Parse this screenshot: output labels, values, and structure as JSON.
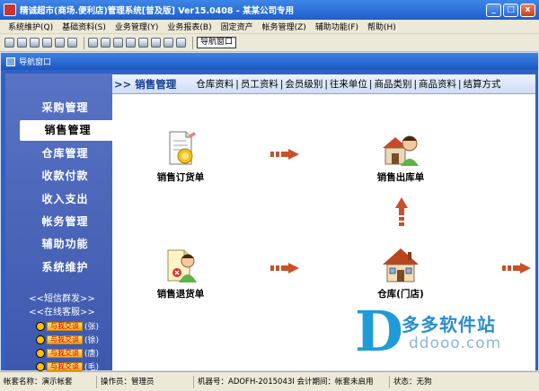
{
  "titlebar": {
    "title": "精诚超市(商场.便利店)管理系统[普及版] Ver15.0408 - 某某公司专用",
    "min_label": "_",
    "max_label": "□",
    "close_label": "x"
  },
  "menubar": {
    "items": [
      "系统维护(Q)",
      "基础资料(S)",
      "业务管理(Y)",
      "业务报表(B)",
      "固定资产",
      "帐务管理(Z)",
      "辅助功能(F)",
      "帮助(H)"
    ]
  },
  "toolbar": {
    "nav_window_button": "导航窗口"
  },
  "nav_window": {
    "title": "导航窗口"
  },
  "sidebar": {
    "items": [
      "采购管理",
      "销售管理",
      "仓库管理",
      "收款付款",
      "收入支出",
      "帐务管理",
      "辅助功能",
      "系统维护"
    ],
    "active_index": 1,
    "sms_link": "<<短信群发>>",
    "service_link": "<<在线客服>>",
    "qq": [
      {
        "button": "与我交谈",
        "name": "(张)"
      },
      {
        "button": "与我交谈",
        "name": "(徐)"
      },
      {
        "button": "与我交谈",
        "name": "(唐)"
      },
      {
        "button": "与我交谈",
        "name": "(毛)"
      }
    ]
  },
  "main": {
    "section_title": ">> 销售管理",
    "tabs": [
      "仓库资料",
      "员工资料",
      "会员级别",
      "往来单位",
      "商品类别",
      "商品资料",
      "结算方式"
    ],
    "tab_separator": "|",
    "features": {
      "sales_order": "销售订货单",
      "sales_delivery": "销售出库单",
      "sales_return": "销售退货单",
      "warehouse": "仓库(门店)"
    }
  },
  "statusbar": {
    "cells": [
      "帐套名称：演示帐套",
      "操作员：管理员",
      "机器号：ADOFH-2015043I 会计期间：帐套未启用",
      "状态：无狗"
    ]
  },
  "watermark": {
    "logo_letter": "D",
    "brand": "多多软件站",
    "url": "ddooo.com"
  },
  "colors": {
    "titlebar": "#1f5fc9",
    "sidebar": "#4a63b8",
    "arrow": "#c8502a",
    "watermark": "#1f9bd8"
  }
}
